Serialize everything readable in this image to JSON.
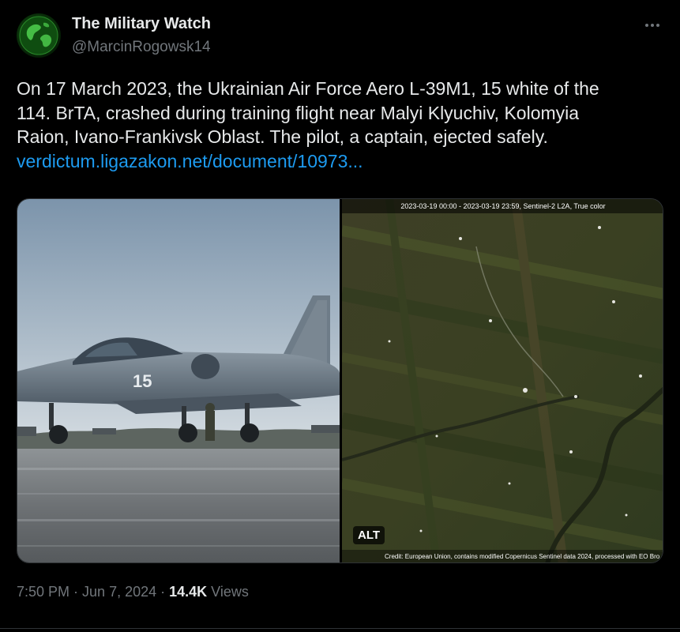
{
  "author": {
    "display_name": "The Military Watch",
    "handle": "@MarcinRogowsk14",
    "avatar_icon": "globe-icon"
  },
  "more_icon": "more-dots-icon",
  "tweet": {
    "text_line1": "On 17 March 2023, the Ukrainian Air Force Aero L-39M1, 15 white of the",
    "text_line2": "114. BrTA, crashed during training flight near Malyi Klyuchiv, Kolomyia",
    "text_line3": "Raion, Ivano-Frankivsk Oblast. The pilot, a captain, ejected safely.",
    "link": "verdictum.ligazakon.net/document/10973..."
  },
  "media": {
    "photo_left_subject": "jet-aircraft",
    "aircraft_number": "15",
    "satellite_header": "2023-03-19 00:00 - 2023-03-19 23:59, Sentinel-2 L2A, True color",
    "satellite_credit": "Credit: European Union, contains modified Copernicus Sentinel data 2024, processed with EO Bro",
    "alt_label": "ALT"
  },
  "meta": {
    "time": "7:50 PM",
    "separator1": " · ",
    "date": "Jun 7, 2024",
    "separator2": " · ",
    "views_count": "14.4K",
    "views_label": " Views"
  },
  "colors": {
    "background": "#000000",
    "text": "#e7e9ea",
    "secondary_text": "#71767b",
    "link": "#1d9bf0",
    "border": "#2f3336"
  }
}
